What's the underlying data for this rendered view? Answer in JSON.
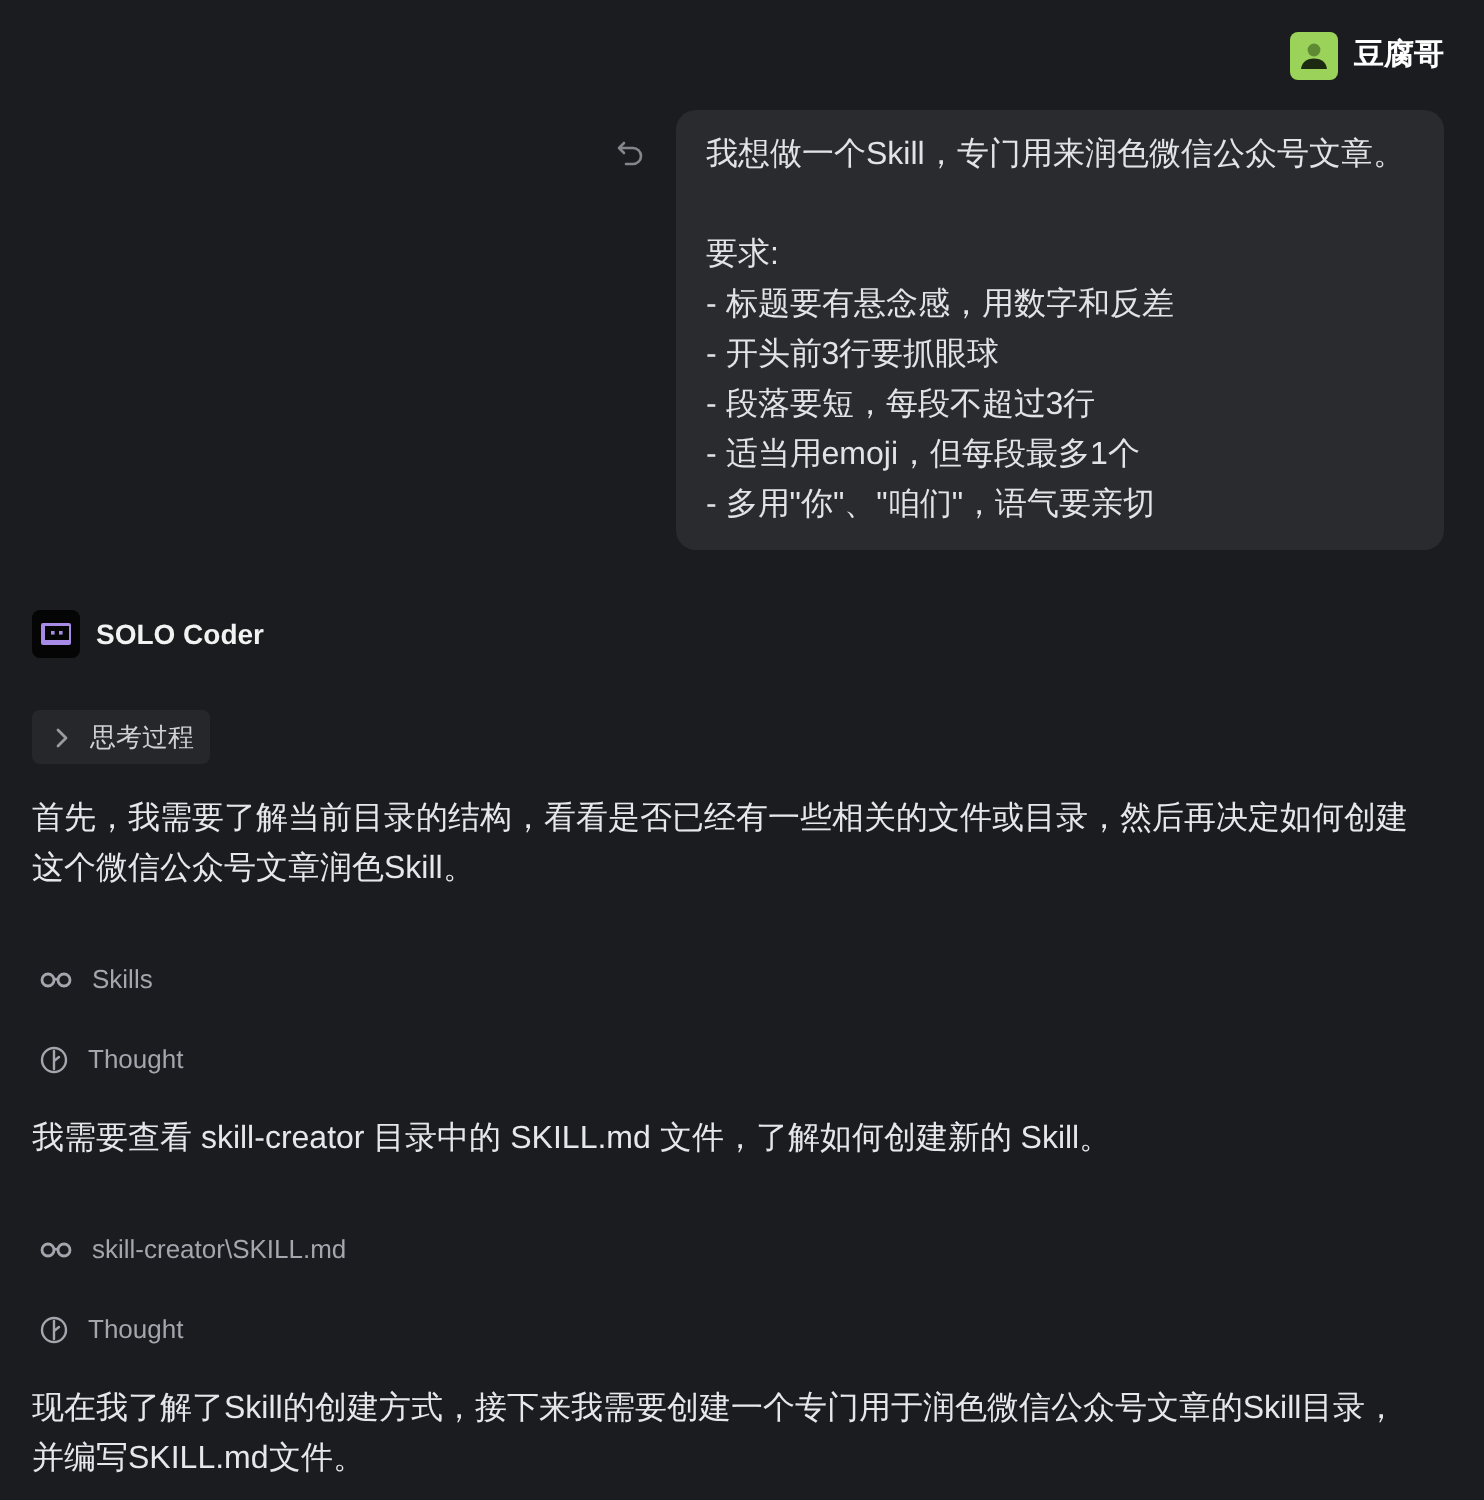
{
  "user_message": {
    "author": "豆腐哥",
    "paragraphs": [
      [
        "我想做一个Skill，专门用来润色微信公众号文章。"
      ],
      [
        "要求:",
        "- 标题要有悬念感，用数字和反差",
        "- 开头前3行要抓眼球",
        "- 段落要短，每段不超过3行",
        "- 适当用emoji，但每段最多1个",
        "- 多用\"你\"、\"咱们\"，语气要亲切"
      ]
    ]
  },
  "assistant": {
    "name": "SOLO Coder",
    "thinking_toggle": {
      "label": "思考过程",
      "expanded": false
    },
    "steps": [
      {
        "kind": "paragraph",
        "text": "首先，我需要了解当前目录的结构，看看是否已经有一些相关的文件或目录，然后再决定如何创建这个微信公众号文章润色Skill。"
      },
      {
        "kind": "tool",
        "label": "Skills"
      },
      {
        "kind": "thought",
        "label": "Thought"
      },
      {
        "kind": "paragraph",
        "text": "我需要查看 skill-creator 目录中的 SKILL.md 文件，了解如何创建新的 Skill。"
      },
      {
        "kind": "tool",
        "label": "skill-creator\\SKILL.md"
      },
      {
        "kind": "thought",
        "label": "Thought"
      },
      {
        "kind": "paragraph",
        "text": "现在我了解了Skill的创建方式，接下来我需要创建一个专门用于润色微信公众号文章的Skill目录，并编写SKILL.md文件。"
      }
    ]
  }
}
